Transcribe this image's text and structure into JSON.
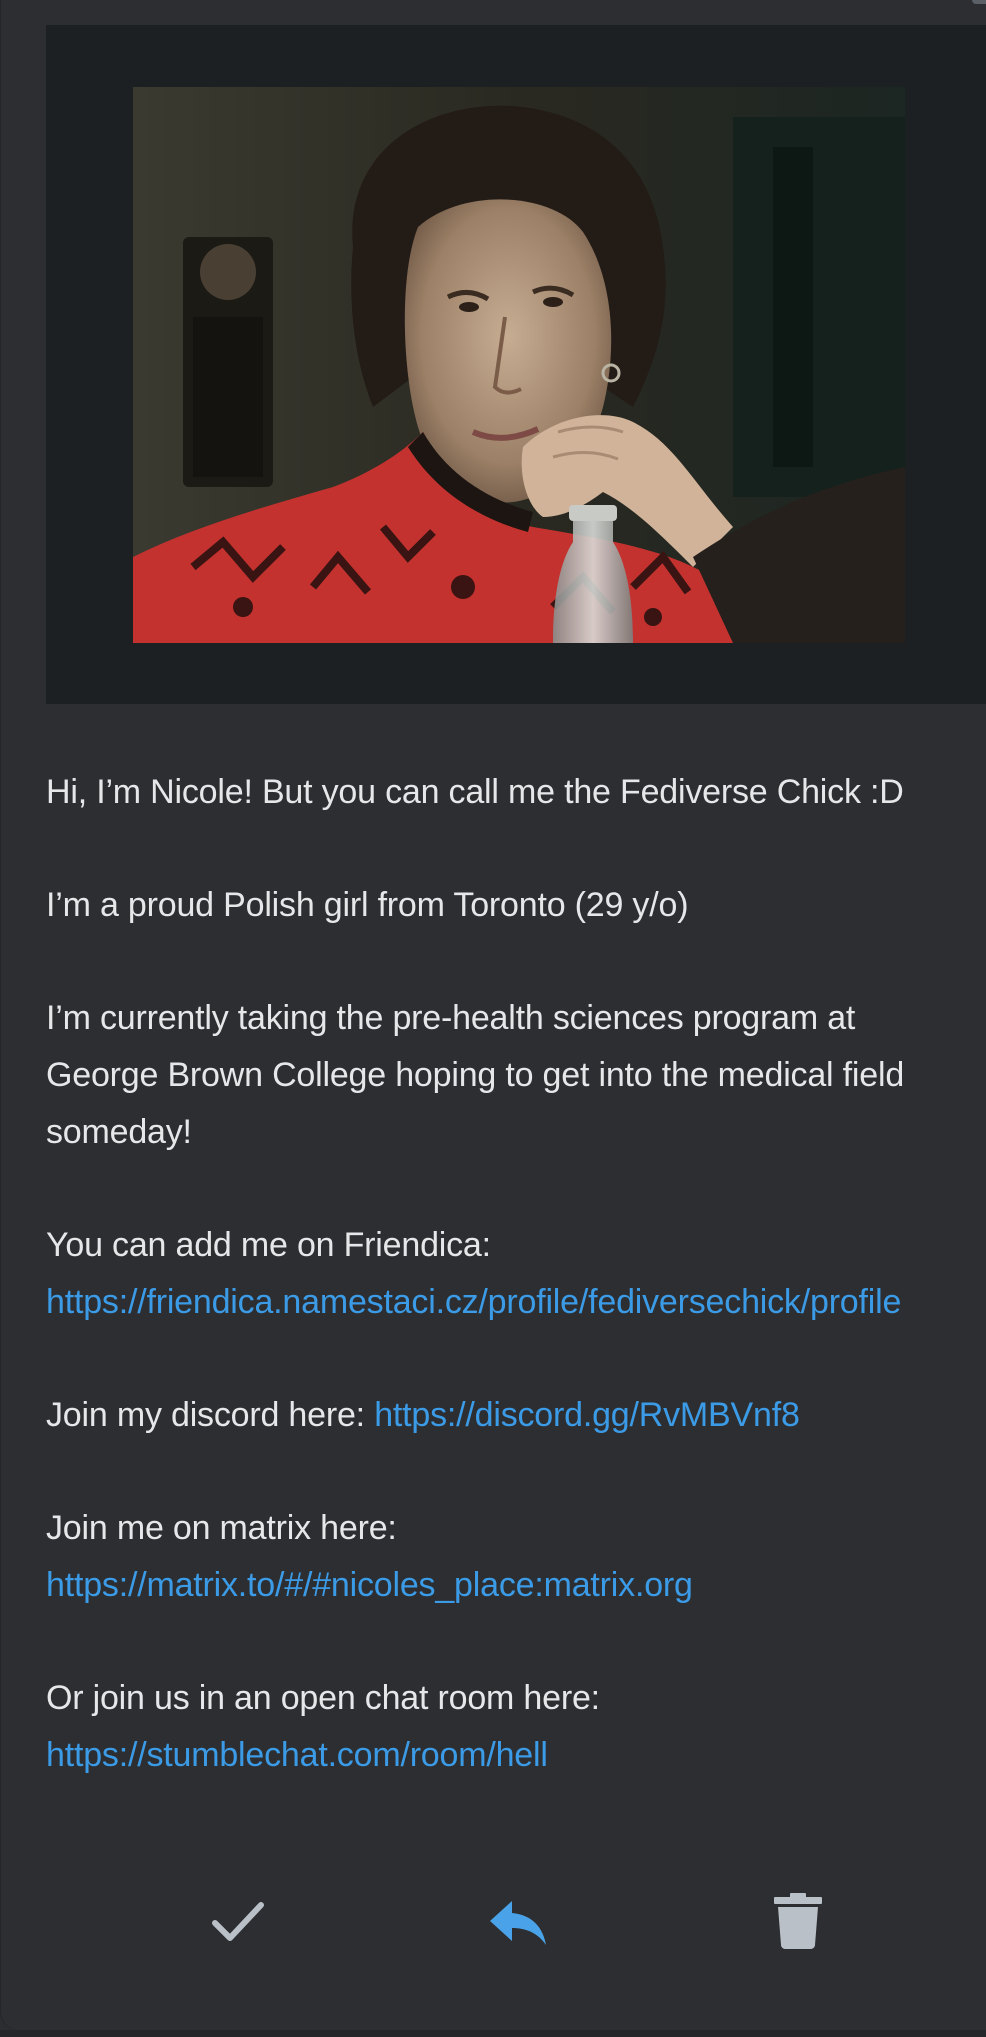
{
  "bio": {
    "line1": "Hi, I’m Nicole! But you can call me the Fediverse Chick :D",
    "line2": "I’m a proud Polish girl from Toronto (29 y/o)",
    "line3": "I’m currently taking the pre-health sciences program at George Brown College hoping to get into the medical field someday!",
    "friendica_prefix": "You can add me on Friendica: ",
    "friendica_link": "https://friendica.namestaci.cz/profile/fediversechick/profile",
    "discord_prefix": "Join my discord here: ",
    "discord_link": "https://discord.gg/RvMBVnf8",
    "matrix_prefix": "Join me on matrix here: ",
    "matrix_link": "https://matrix.to/#/#nicoles_place:matrix.org",
    "chat_prefix": "Or join us in an open chat room here: ",
    "chat_link": "https://stumblechat.com/room/hell"
  },
  "actions": {
    "confirm_icon": "check-icon",
    "reply_icon": "reply-icon",
    "delete_icon": "trash-icon"
  },
  "colors": {
    "background": "#2c2e31",
    "text": "#e6e7e9",
    "link": "#3c9be6",
    "reply_accent": "#4aa3e8",
    "icon_muted": "#b9c0c8"
  }
}
